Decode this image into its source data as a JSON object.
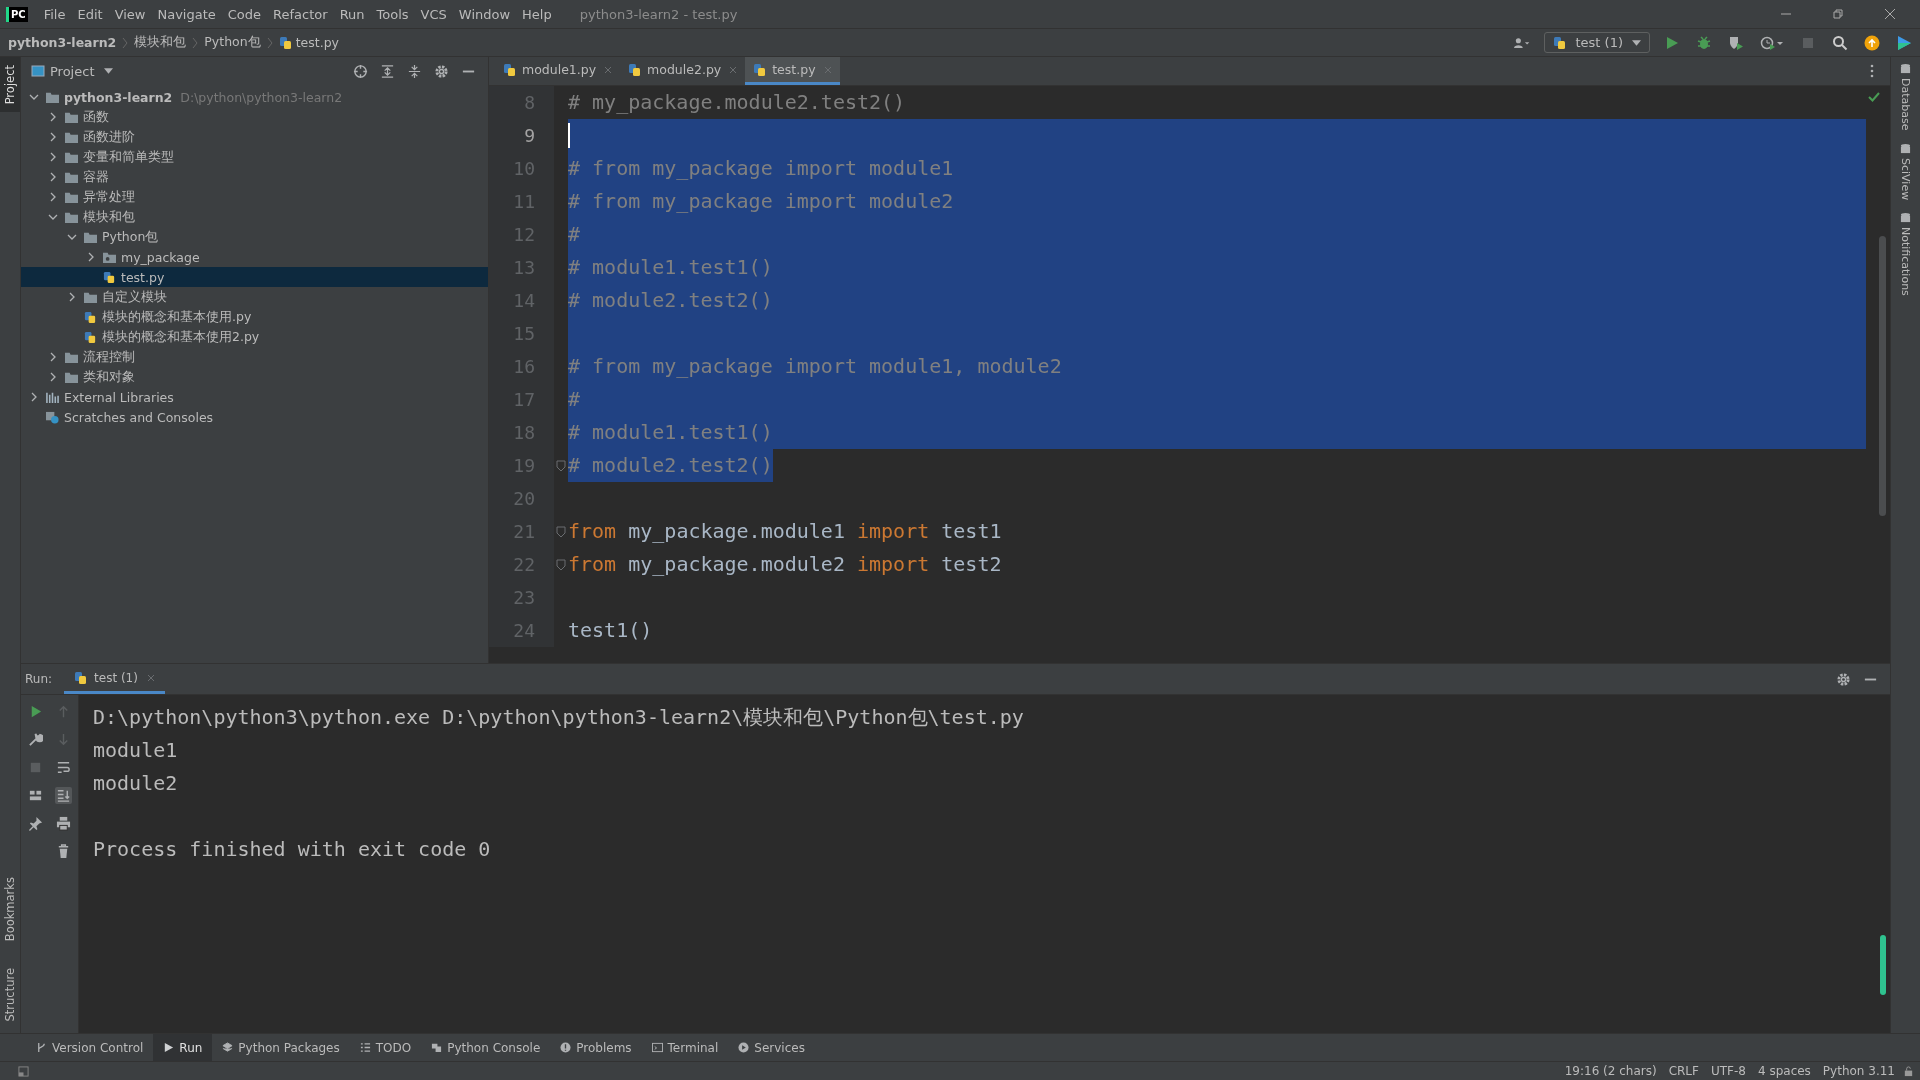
{
  "menu": [
    "File",
    "Edit",
    "View",
    "Navigate",
    "Code",
    "Refactor",
    "Run",
    "Tools",
    "VCS",
    "Window",
    "Help"
  ],
  "window": {
    "title": "python3-learn2 - test.py",
    "logo": "PC"
  },
  "breadcrumbs": [
    "python3-learn2",
    "模块和包",
    "Python包",
    "test.py"
  ],
  "run_config": {
    "label": "test (1)"
  },
  "left_stripe": [
    {
      "label": "Project",
      "selected": true,
      "kind": "top"
    },
    {
      "label": "Bookmarks",
      "selected": false,
      "kind": "bottom"
    },
    {
      "label": "Structure",
      "selected": false,
      "kind": "bottom"
    }
  ],
  "right_stripe": [
    {
      "label": "Database"
    },
    {
      "label": "SciView"
    },
    {
      "label": "Notifications"
    }
  ],
  "project_panel": {
    "title": "Project"
  },
  "project_tree": [
    {
      "label": "python3-learn2",
      "path": "D:\\python\\python3-learn2",
      "kind": "folder",
      "expanded": true,
      "selected": false,
      "children": [
        {
          "label": "函数",
          "kind": "folder",
          "expanded": false,
          "selected": false
        },
        {
          "label": "函数进阶",
          "kind": "folder",
          "expanded": false,
          "selected": false
        },
        {
          "label": "变量和简单类型",
          "kind": "folder",
          "expanded": false,
          "selected": false
        },
        {
          "label": "容器",
          "kind": "folder",
          "expanded": false,
          "selected": false
        },
        {
          "label": "异常处理",
          "kind": "folder",
          "expanded": false,
          "selected": false
        },
        {
          "label": "模块和包",
          "kind": "folder",
          "expanded": true,
          "selected": false,
          "children": [
            {
              "label": "Python包",
              "kind": "folder",
              "expanded": true,
              "selected": false,
              "children": [
                {
                  "label": "my_package",
                  "kind": "package",
                  "expanded": false,
                  "selected": false
                },
                {
                  "label": "test.py",
                  "kind": "file",
                  "selected": true
                }
              ]
            },
            {
              "label": "自定义模块",
              "kind": "folder",
              "expanded": false,
              "selected": false
            },
            {
              "label": "模块的概念和基本使用.py",
              "kind": "file",
              "selected": false
            },
            {
              "label": "模块的概念和基本使用2.py",
              "kind": "file",
              "selected": false
            }
          ]
        },
        {
          "label": "流程控制",
          "kind": "folder",
          "expanded": false,
          "selected": false
        },
        {
          "label": "类和对象",
          "kind": "folder",
          "expanded": false,
          "selected": false
        }
      ]
    },
    {
      "label": "External Libraries",
      "kind": "libraries",
      "expanded": false,
      "selected": false
    },
    {
      "label": "Scratches and Consoles",
      "kind": "scratches",
      "selected": false
    }
  ],
  "editor_tabs": [
    {
      "label": "module1.py",
      "selected": false
    },
    {
      "label": "module2.py",
      "selected": false
    },
    {
      "label": "test.py",
      "selected": true
    }
  ],
  "code_lines": [
    {
      "number": "8",
      "selected": false,
      "current": false,
      "fold": false,
      "segments": [
        {
          "text": "# my_package.module2.test2()",
          "kind": "comment"
        }
      ]
    },
    {
      "number": "9",
      "selected": true,
      "full_width": true,
      "current": true,
      "fold": false
    },
    {
      "number": "10",
      "selected": true,
      "full_width": true,
      "current": false,
      "fold": false,
      "segments": [
        {
          "text": "# from my_package import module1",
          "kind": "comment"
        }
      ]
    },
    {
      "number": "11",
      "selected": true,
      "full_width": true,
      "current": false,
      "fold": false,
      "segments": [
        {
          "text": "# from my_package import module2",
          "kind": "comment"
        }
      ]
    },
    {
      "number": "12",
      "selected": true,
      "full_width": true,
      "current": false,
      "fold": false,
      "segments": [
        {
          "text": "#",
          "kind": "comment"
        }
      ]
    },
    {
      "number": "13",
      "selected": true,
      "full_width": true,
      "current": false,
      "fold": false,
      "segments": [
        {
          "text": "# module1.test1()",
          "kind": "comment"
        }
      ]
    },
    {
      "number": "14",
      "selected": true,
      "full_width": true,
      "current": false,
      "fold": false,
      "segments": [
        {
          "text": "# module2.test2()",
          "kind": "comment"
        }
      ]
    },
    {
      "number": "15",
      "selected": true,
      "full_width": true,
      "current": false,
      "fold": false
    },
    {
      "number": "16",
      "selected": true,
      "full_width": true,
      "current": false,
      "fold": false,
      "segments": [
        {
          "text": "# from my_package import module1, module2",
          "kind": "comment"
        }
      ]
    },
    {
      "number": "17",
      "selected": true,
      "full_width": true,
      "current": false,
      "fold": false,
      "segments": [
        {
          "text": "#",
          "kind": "comment"
        }
      ]
    },
    {
      "number": "18",
      "selected": true,
      "full_width": true,
      "current": false,
      "fold": false,
      "segments": [
        {
          "text": "# module1.test1()",
          "kind": "comment"
        }
      ]
    },
    {
      "number": "19",
      "selected": true,
      "full_width": false,
      "current": false,
      "fold": true,
      "segments": [
        {
          "text": "# module2.test2()",
          "kind": "comment"
        }
      ]
    },
    {
      "number": "20",
      "selected": false,
      "current": false,
      "fold": false
    },
    {
      "number": "21",
      "selected": false,
      "current": false,
      "fold": true,
      "segments": [
        {
          "text": "from",
          "kind": "keyword"
        },
        {
          "text": " my_package.module1 ",
          "kind": "plain"
        },
        {
          "text": "import",
          "kind": "keyword"
        },
        {
          "text": " test1",
          "kind": "plain"
        }
      ]
    },
    {
      "number": "22",
      "selected": false,
      "current": false,
      "fold": true,
      "segments": [
        {
          "text": "from",
          "kind": "keyword"
        },
        {
          "text": " my_package.module2 ",
          "kind": "plain"
        },
        {
          "text": "import",
          "kind": "keyword"
        },
        {
          "text": " test2",
          "kind": "plain"
        }
      ]
    },
    {
      "number": "23",
      "selected": false,
      "current": false,
      "fold": false
    },
    {
      "number": "24",
      "selected": false,
      "current": false,
      "fold": false,
      "segments": [
        {
          "text": "test1()",
          "kind": "plain"
        }
      ]
    }
  ],
  "run_panel": {
    "title": "Run:",
    "tabs": [
      {
        "label": "test (1)",
        "selected": true
      }
    ],
    "output": [
      {
        "text": "D:\\python\\python3\\python.exe D:\\python\\python3-learn2\\模块和包\\Python包\\test.py",
        "gap_before": false
      },
      {
        "text": "module1",
        "gap_before": false
      },
      {
        "text": "module2",
        "gap_before": false
      },
      {
        "text": "Process finished with exit code 0",
        "gap_before": true
      }
    ]
  },
  "tool_windows": [
    {
      "label": "Version Control",
      "selected": false
    },
    {
      "label": "Run",
      "selected": true
    },
    {
      "label": "Python Packages",
      "selected": false
    },
    {
      "label": "TODO",
      "selected": false
    },
    {
      "label": "Python Console",
      "selected": false
    },
    {
      "label": "Problems",
      "selected": false
    },
    {
      "label": "Terminal",
      "selected": false
    },
    {
      "label": "Services",
      "selected": false
    }
  ],
  "status_bar": [
    "19:16 (2 chars)",
    "CRLF",
    "UTF-8",
    "4 spaces",
    "Python 3.11"
  ]
}
